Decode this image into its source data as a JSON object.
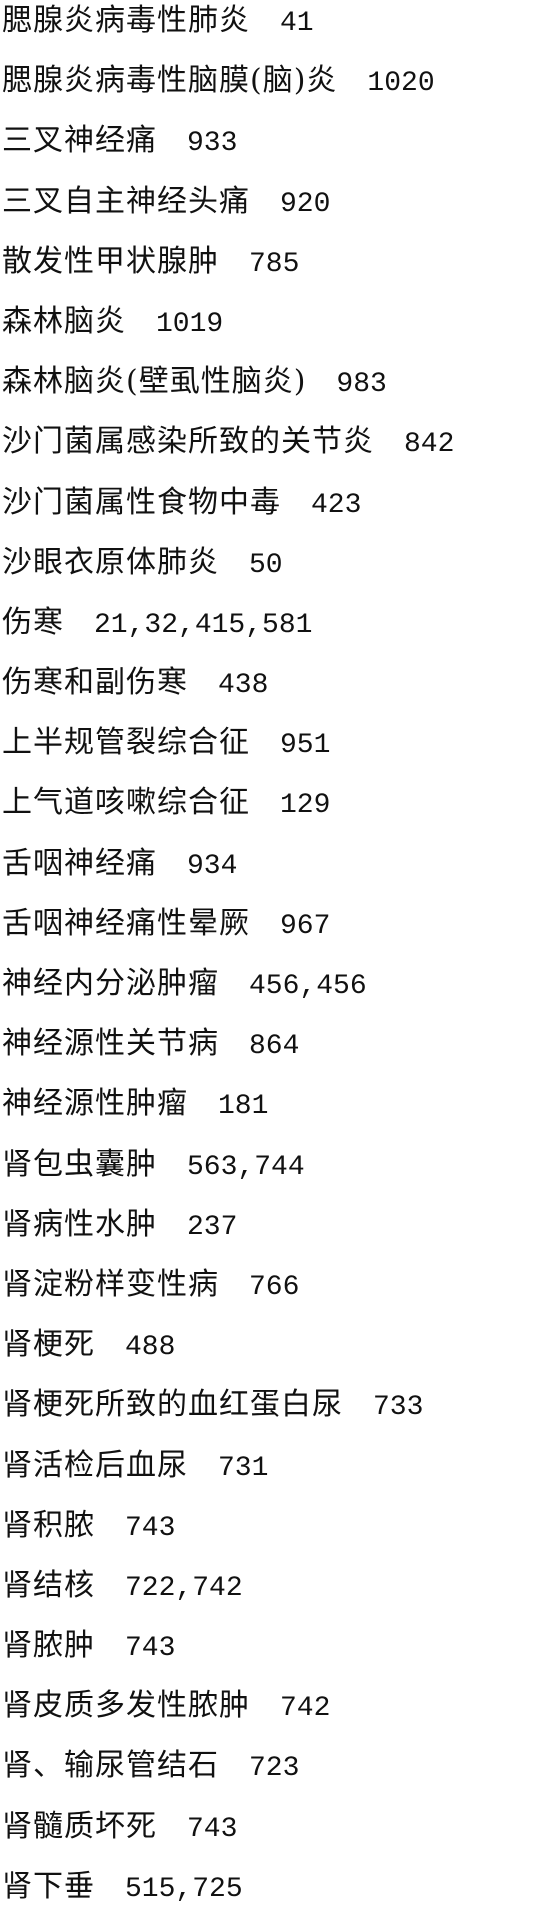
{
  "entries": [
    {
      "term": "腮腺炎病毒性肺炎",
      "pages": "41"
    },
    {
      "term": "腮腺炎病毒性脑膜(脑)炎",
      "pages": "1020"
    },
    {
      "term": "三叉神经痛",
      "pages": "933"
    },
    {
      "term": "三叉自主神经头痛",
      "pages": "920"
    },
    {
      "term": "散发性甲状腺肿",
      "pages": "785"
    },
    {
      "term": "森林脑炎",
      "pages": "1019"
    },
    {
      "term": "森林脑炎(壁虱性脑炎)",
      "pages": "983"
    },
    {
      "term": "沙门菌属感染所致的关节炎",
      "pages": "842"
    },
    {
      "term": "沙门菌属性食物中毒",
      "pages": "423"
    },
    {
      "term": "沙眼衣原体肺炎",
      "pages": "50"
    },
    {
      "term": "伤寒",
      "pages": "21,32,415,581"
    },
    {
      "term": "伤寒和副伤寒",
      "pages": "438"
    },
    {
      "term": "上半规管裂综合征",
      "pages": "951"
    },
    {
      "term": "上气道咳嗽综合征",
      "pages": "129"
    },
    {
      "term": "舌咽神经痛",
      "pages": "934"
    },
    {
      "term": "舌咽神经痛性晕厥",
      "pages": "967"
    },
    {
      "term": "神经内分泌肿瘤",
      "pages": "456,456"
    },
    {
      "term": "神经源性关节病",
      "pages": "864"
    },
    {
      "term": "神经源性肿瘤",
      "pages": "181"
    },
    {
      "term": "肾包虫囊肿",
      "pages": "563,744"
    },
    {
      "term": "肾病性水肿",
      "pages": "237"
    },
    {
      "term": "肾淀粉样变性病",
      "pages": "766"
    },
    {
      "term": "肾梗死",
      "pages": "488"
    },
    {
      "term": "肾梗死所致的血红蛋白尿",
      "pages": "733"
    },
    {
      "term": "肾活检后血尿",
      "pages": "731"
    },
    {
      "term": "肾积脓",
      "pages": "743"
    },
    {
      "term": "肾结核",
      "pages": "722,742"
    },
    {
      "term": "肾脓肿",
      "pages": "743"
    },
    {
      "term": "肾皮质多发性脓肿",
      "pages": "742"
    },
    {
      "term": "肾、输尿管结石",
      "pages": "723"
    },
    {
      "term": "肾髓质坏死",
      "pages": "743"
    },
    {
      "term": "肾下垂",
      "pages": "515,725"
    }
  ]
}
